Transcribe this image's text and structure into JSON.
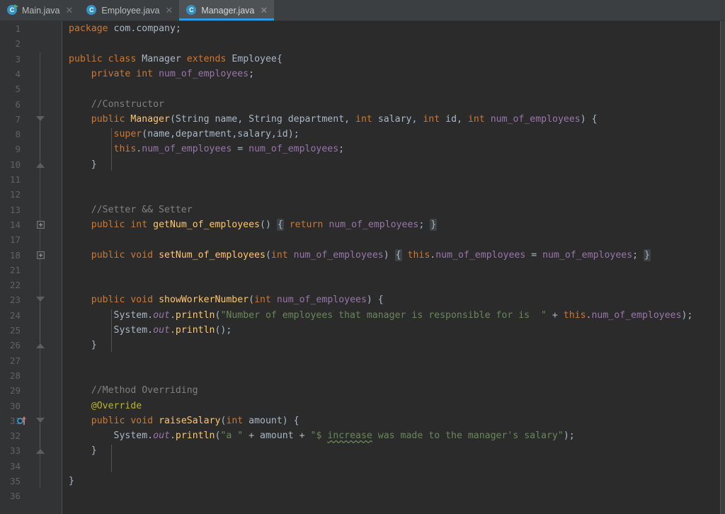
{
  "window": {
    "theme": "darcula",
    "colors": {
      "editor_bg": "#2b2b2b",
      "gutter_bg": "#313335",
      "tabbar_bg": "#3c3f41",
      "active_tab_bg": "#4e5254",
      "active_tab_underline": "#2d9ae6",
      "keyword": "#cc7832",
      "field": "#9876aa",
      "string": "#6a8759",
      "comment": "#808080",
      "annotation": "#bbb529",
      "method": "#ffc66d",
      "default_text": "#a9b7c6",
      "line_number": "#606366"
    }
  },
  "tabs": [
    {
      "label": "Main.java",
      "icon": "java-class-runnable-icon",
      "close_icon": "close-icon",
      "active": false
    },
    {
      "label": "Employee.java",
      "icon": "java-class-icon",
      "close_icon": "close-icon",
      "active": false
    },
    {
      "label": "Manager.java",
      "icon": "java-class-icon",
      "close_icon": "close-icon",
      "active": true
    }
  ],
  "editor": {
    "file": "Manager.java",
    "language": "java",
    "lines": [
      {
        "num": "1",
        "fold": "none",
        "text": "package com.company;"
      },
      {
        "num": "2",
        "fold": "none",
        "text": ""
      },
      {
        "num": "3",
        "fold": "none",
        "text": "public class Manager extends Employee{"
      },
      {
        "num": "4",
        "fold": "none",
        "text": "    private int num_of_employees;"
      },
      {
        "num": "5",
        "fold": "none",
        "text": ""
      },
      {
        "num": "6",
        "fold": "none",
        "text": "    //Constructor"
      },
      {
        "num": "7",
        "fold": "chev-down",
        "text": "    public Manager(String name, String department, int salary, int id, int num_of_employees) {"
      },
      {
        "num": "8",
        "fold": "none",
        "text": "        super(name,department,salary,id);"
      },
      {
        "num": "9",
        "fold": "none",
        "text": "        this.num_of_employees = num_of_employees;"
      },
      {
        "num": "10",
        "fold": "chev-up",
        "text": "    }"
      },
      {
        "num": "11",
        "fold": "none",
        "text": ""
      },
      {
        "num": "12",
        "fold": "none",
        "text": ""
      },
      {
        "num": "13",
        "fold": "none",
        "text": "    //Setter && Setter"
      },
      {
        "num": "14",
        "fold": "plus",
        "text": "    public int getNum_of_employees() { return num_of_employees; }"
      },
      {
        "num": "17",
        "fold": "none",
        "text": ""
      },
      {
        "num": "18",
        "fold": "plus",
        "text": "    public void setNum_of_employees(int num_of_employees) { this.num_of_employees = num_of_employees; }"
      },
      {
        "num": "21",
        "fold": "none",
        "text": ""
      },
      {
        "num": "22",
        "fold": "none",
        "text": ""
      },
      {
        "num": "23",
        "fold": "chev-down",
        "text": "    public void showWorkerNumber(int num_of_employees) {"
      },
      {
        "num": "24",
        "fold": "none",
        "text": "        System.out.println(\"Number of employees that manager is responsible for is  \" + this.num_of_employees);"
      },
      {
        "num": "25",
        "fold": "none",
        "text": "        System.out.println();"
      },
      {
        "num": "26",
        "fold": "chev-up",
        "text": "    }"
      },
      {
        "num": "27",
        "fold": "none",
        "text": ""
      },
      {
        "num": "28",
        "fold": "none",
        "text": ""
      },
      {
        "num": "29",
        "fold": "none",
        "text": "    //Method Overriding"
      },
      {
        "num": "30",
        "fold": "none",
        "text": "    @Override"
      },
      {
        "num": "31",
        "fold": "chev-down",
        "text": "    public void raiseSalary(int amount) {",
        "gutter_icon": "overriding-method-icon"
      },
      {
        "num": "32",
        "fold": "none",
        "text": "        System.out.println(\"a \" + amount + \"$ increase was made to the manager's salary\");"
      },
      {
        "num": "33",
        "fold": "chev-up",
        "text": "    }"
      },
      {
        "num": "34",
        "fold": "none",
        "text": ""
      },
      {
        "num": "35",
        "fold": "none",
        "text": "}"
      },
      {
        "num": "36",
        "fold": "none",
        "text": ""
      }
    ],
    "spellcheck_warnings": [
      "increase"
    ]
  }
}
